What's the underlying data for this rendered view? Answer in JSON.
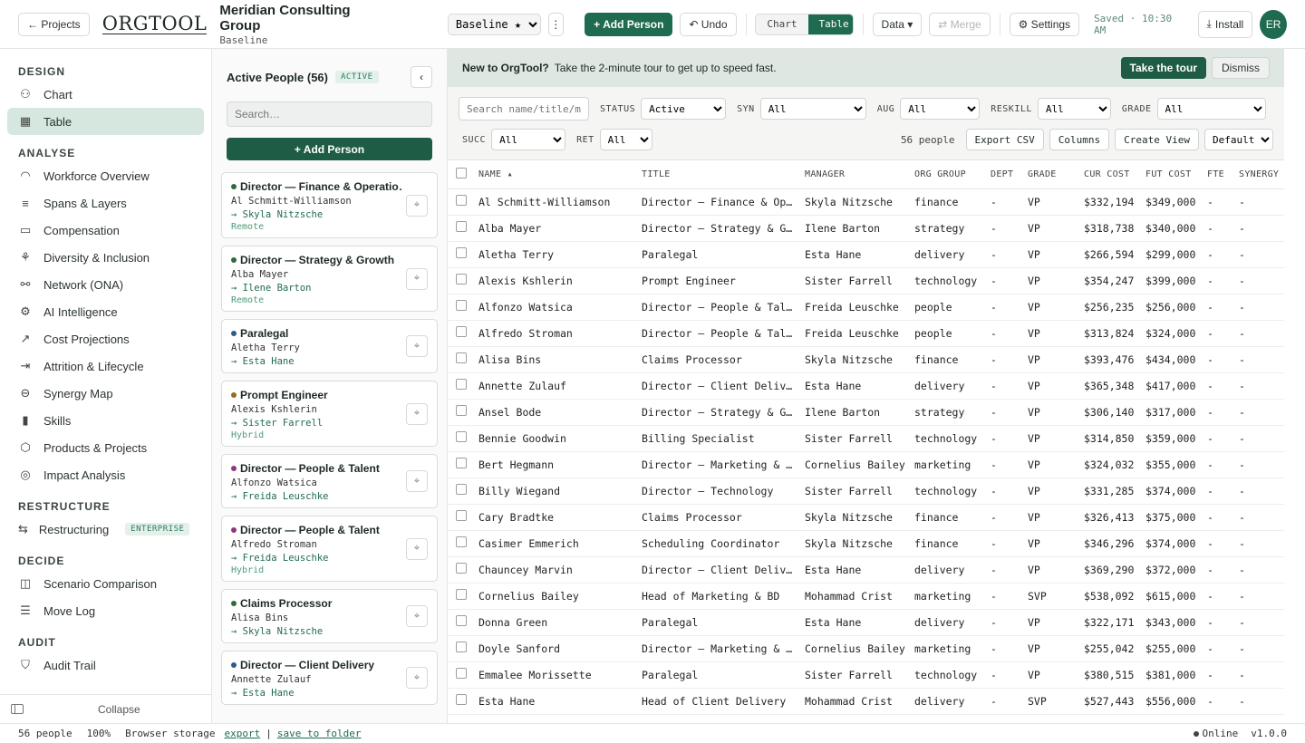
{
  "header": {
    "back_label": "← Projects",
    "logo": "ORGTOOL",
    "company": "Meridian Consulting Group",
    "scenario_sub": "Baseline",
    "scenario_select": "Baseline ★",
    "add_person": "+ Add Person",
    "undo": "↶ Undo",
    "view_chart": "Chart",
    "view_table": "Table",
    "data_menu": "Data ▾",
    "merge": "⇄ Merge",
    "settings": "⚙ Settings",
    "saved": "Saved · 10:30 AM",
    "install": "Install",
    "avatar": "ER"
  },
  "sidebar": {
    "sections": [
      {
        "title": "DESIGN",
        "items": [
          {
            "label": "Chart",
            "icon": "org-chart-icon",
            "active": false
          },
          {
            "label": "Table",
            "icon": "table-icon",
            "active": true
          }
        ]
      },
      {
        "title": "ANALYSE",
        "items": [
          {
            "label": "Workforce Overview",
            "icon": "gauge-icon"
          },
          {
            "label": "Spans & Layers",
            "icon": "layers-icon"
          },
          {
            "label": "Compensation",
            "icon": "banknote-icon"
          },
          {
            "label": "Diversity & Inclusion",
            "icon": "nodes-icon"
          },
          {
            "label": "Network (ONA)",
            "icon": "network-icon"
          },
          {
            "label": "AI Intelligence",
            "icon": "chip-icon"
          },
          {
            "label": "Cost Projections",
            "icon": "trend-icon"
          },
          {
            "label": "Attrition & Lifecycle",
            "icon": "exit-icon"
          },
          {
            "label": "Synergy Map",
            "icon": "overlap-icon"
          },
          {
            "label": "Skills",
            "icon": "bars-icon"
          },
          {
            "label": "Products & Projects",
            "icon": "box-icon"
          },
          {
            "label": "Impact Analysis",
            "icon": "target-icon"
          }
        ]
      },
      {
        "title": "RESTRUCTURE",
        "items": [
          {
            "label": "Restructuring",
            "icon": "swap-icon",
            "badge": "ENTERPRISE"
          }
        ]
      },
      {
        "title": "DECIDE",
        "items": [
          {
            "label": "Scenario Comparison",
            "icon": "compare-icon"
          },
          {
            "label": "Move Log",
            "icon": "list-icon"
          }
        ]
      },
      {
        "title": "AUDIT",
        "items": [
          {
            "label": "Audit Trail",
            "icon": "shield-icon"
          }
        ]
      }
    ],
    "collapse": "Collapse"
  },
  "people_panel": {
    "title": "Active People (56)",
    "tag": "ACTIVE",
    "search_placeholder": "Search…",
    "add_label": "+ Add Person",
    "cards": [
      {
        "title": "Director — Finance & Operatio…",
        "name": "Al Schmitt-Williamson",
        "manager": "→ Skyla Nitzsche",
        "location": "Remote",
        "color": "#2f6b3a"
      },
      {
        "title": "Director — Strategy & Growth",
        "name": "Alba Mayer",
        "manager": "→ Ilene Barton",
        "location": "Remote",
        "color": "#2f6b3a"
      },
      {
        "title": "Paralegal",
        "name": "Aletha Terry",
        "manager": "→ Esta Hane",
        "location": "",
        "color": "#2b5c8a"
      },
      {
        "title": "Prompt Engineer",
        "name": "Alexis Kshlerin",
        "manager": "→ Sister Farrell",
        "location": "Hybrid",
        "color": "#9a6a1e"
      },
      {
        "title": "Director — People & Talent",
        "name": "Alfonzo Watsica",
        "manager": "→ Freida Leuschke",
        "location": "",
        "color": "#8a3a7a"
      },
      {
        "title": "Director — People & Talent",
        "name": "Alfredo Stroman",
        "manager": "→ Freida Leuschke",
        "location": "Hybrid",
        "color": "#8a3a7a"
      },
      {
        "title": "Claims Processor",
        "name": "Alisa Bins",
        "manager": "→ Skyla Nitzsche",
        "location": "",
        "color": "#2f6b3a"
      },
      {
        "title": "Director — Client Delivery",
        "name": "Annette Zulauf",
        "manager": "→ Esta Hane",
        "location": "",
        "color": "#2b5c8a"
      }
    ]
  },
  "banner": {
    "bold": "New to OrgTool?",
    "text": "Take the 2-minute tour to get up to speed fast.",
    "tour": "Take the tour",
    "dismiss": "Dismiss"
  },
  "filters": {
    "search_placeholder": "Search name/title/m",
    "status_label": "STATUS",
    "status_value": "Active",
    "syn_label": "SYN",
    "syn_value": "All",
    "aug_label": "AUG",
    "aug_value": "All",
    "reskill_label": "RESKILL",
    "reskill_value": "All",
    "grade_label": "GRADE",
    "grade_value": "All",
    "succ_label": "SUCC",
    "succ_value": "All",
    "ret_label": "RET",
    "ret_value": "All",
    "count": "56 people",
    "export_csv": "Export CSV",
    "columns": "Columns",
    "create_view": "Create View",
    "view_select": "Default"
  },
  "table": {
    "columns": [
      "NAME ▴",
      "TITLE",
      "MANAGER",
      "ORG GROUP",
      "DEPT",
      "GRADE",
      "CUR COST",
      "FUT COST",
      "FTE",
      "SYNERGY"
    ],
    "rows": [
      [
        "Al Schmitt-Williamson",
        "Director — Finance & Op…",
        "Skyla Nitzsche",
        "finance",
        "-",
        "VP",
        "$332,194",
        "$349,000",
        "-",
        "-"
      ],
      [
        "Alba Mayer",
        "Director — Strategy & G…",
        "Ilene Barton",
        "strategy",
        "-",
        "VP",
        "$318,738",
        "$340,000",
        "-",
        "-"
      ],
      [
        "Aletha Terry",
        "Paralegal",
        "Esta Hane",
        "delivery",
        "-",
        "VP",
        "$266,594",
        "$299,000",
        "-",
        "-"
      ],
      [
        "Alexis Kshlerin",
        "Prompt Engineer",
        "Sister Farrell",
        "technology",
        "-",
        "VP",
        "$354,247",
        "$399,000",
        "-",
        "-"
      ],
      [
        "Alfonzo Watsica",
        "Director — People & Tal…",
        "Freida Leuschke",
        "people",
        "-",
        "VP",
        "$256,235",
        "$256,000",
        "-",
        "-"
      ],
      [
        "Alfredo Stroman",
        "Director — People & Tal…",
        "Freida Leuschke",
        "people",
        "-",
        "VP",
        "$313,824",
        "$324,000",
        "-",
        "-"
      ],
      [
        "Alisa Bins",
        "Claims Processor",
        "Skyla Nitzsche",
        "finance",
        "-",
        "VP",
        "$393,476",
        "$434,000",
        "-",
        "-"
      ],
      [
        "Annette Zulauf",
        "Director — Client Deliv…",
        "Esta Hane",
        "delivery",
        "-",
        "VP",
        "$365,348",
        "$417,000",
        "-",
        "-"
      ],
      [
        "Ansel Bode",
        "Director — Strategy & G…",
        "Ilene Barton",
        "strategy",
        "-",
        "VP",
        "$306,140",
        "$317,000",
        "-",
        "-"
      ],
      [
        "Bennie Goodwin",
        "Billing Specialist",
        "Sister Farrell",
        "technology",
        "-",
        "VP",
        "$314,850",
        "$359,000",
        "-",
        "-"
      ],
      [
        "Bert Hegmann",
        "Director — Marketing & …",
        "Cornelius Bailey",
        "marketing",
        "-",
        "VP",
        "$324,032",
        "$355,000",
        "-",
        "-"
      ],
      [
        "Billy Wiegand",
        "Director — Technology",
        "Sister Farrell",
        "technology",
        "-",
        "VP",
        "$331,285",
        "$374,000",
        "-",
        "-"
      ],
      [
        "Cary Bradtke",
        "Claims Processor",
        "Skyla Nitzsche",
        "finance",
        "-",
        "VP",
        "$326,413",
        "$375,000",
        "-",
        "-"
      ],
      [
        "Casimer Emmerich",
        "Scheduling Coordinator",
        "Skyla Nitzsche",
        "finance",
        "-",
        "VP",
        "$346,296",
        "$374,000",
        "-",
        "-"
      ],
      [
        "Chauncey Marvin",
        "Director — Client Deliv…",
        "Esta Hane",
        "delivery",
        "-",
        "VP",
        "$369,290",
        "$372,000",
        "-",
        "-"
      ],
      [
        "Cornelius Bailey",
        "Head of Marketing & BD",
        "Mohammad Crist",
        "marketing",
        "-",
        "SVP",
        "$538,092",
        "$615,000",
        "-",
        "-"
      ],
      [
        "Donna Green",
        "Paralegal",
        "Esta Hane",
        "delivery",
        "-",
        "VP",
        "$322,171",
        "$343,000",
        "-",
        "-"
      ],
      [
        "Doyle Sanford",
        "Director — Marketing & …",
        "Cornelius Bailey",
        "marketing",
        "-",
        "VP",
        "$255,042",
        "$255,000",
        "-",
        "-"
      ],
      [
        "Emmalee Morissette",
        "Paralegal",
        "Sister Farrell",
        "technology",
        "-",
        "VP",
        "$380,515",
        "$381,000",
        "-",
        "-"
      ],
      [
        "Esta Hane",
        "Head of Client Delivery",
        "Mohammad Crist",
        "delivery",
        "-",
        "SVP",
        "$527,443",
        "$556,000",
        "-",
        "-"
      ]
    ]
  },
  "statusbar": {
    "people": "56 people",
    "zoom": "100%",
    "storage": "Browser storage",
    "export": "export",
    "divider": "|",
    "save": "save to folder",
    "online": "Online",
    "version": "v1.0.0"
  }
}
